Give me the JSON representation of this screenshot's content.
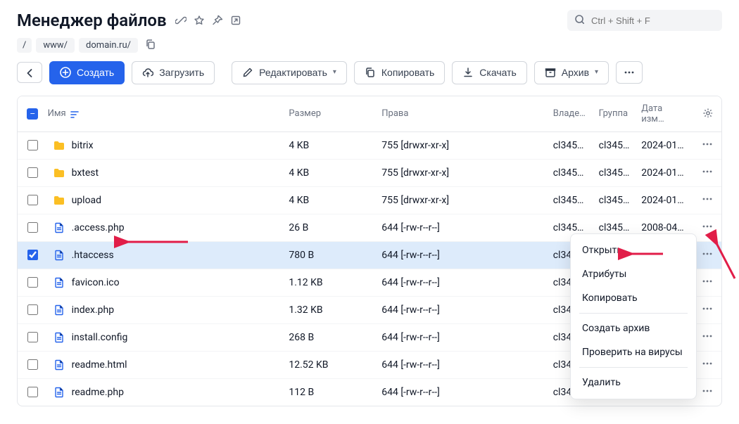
{
  "header": {
    "title": "Менеджер файлов"
  },
  "search": {
    "placeholder": "Ctrl + Shift + F"
  },
  "breadcrumb": {
    "root": "/",
    "parts": [
      "www/",
      "domain.ru/"
    ]
  },
  "toolbar": {
    "create": "Создать",
    "upload": "Загрузить",
    "edit": "Редактировать",
    "copy": "Копировать",
    "download": "Скачать",
    "archive": "Архив"
  },
  "columns": {
    "name": "Имя",
    "size": "Размер",
    "perm": "Права",
    "owner": "Владе…",
    "group": "Группа",
    "date": "Дата изм…"
  },
  "rows": [
    {
      "selected": false,
      "type": "folder",
      "name": "bitrix",
      "size": "4 KB",
      "perm": "755 [drwxr-xr-x]",
      "owner": "cl345…",
      "group": "cl345…",
      "date": "2024-01…"
    },
    {
      "selected": false,
      "type": "folder",
      "name": "bxtest",
      "size": "4 KB",
      "perm": "755 [drwxr-xr-x]",
      "owner": "cl345…",
      "group": "cl345…",
      "date": "2024-01…"
    },
    {
      "selected": false,
      "type": "folder",
      "name": "upload",
      "size": "4 KB",
      "perm": "755 [drwxr-xr-x]",
      "owner": "cl345…",
      "group": "cl345…",
      "date": "2024-01…"
    },
    {
      "selected": false,
      "type": "file",
      "name": ".access.php",
      "size": "26 B",
      "perm": "644 [-rw-r--r--]",
      "owner": "cl345…",
      "group": "cl345…",
      "date": "2008-04…"
    },
    {
      "selected": true,
      "type": "file",
      "name": ".htaccess",
      "size": "780 B",
      "perm": "644 [-rw-r--r--]",
      "owner": "cl345",
      "group": "",
      "date": ""
    },
    {
      "selected": false,
      "type": "file",
      "name": "favicon.ico",
      "size": "1.12 KB",
      "perm": "644 [-rw-r--r--]",
      "owner": "cl345",
      "group": "",
      "date": ""
    },
    {
      "selected": false,
      "type": "file",
      "name": "index.php",
      "size": "1.32 KB",
      "perm": "644 [-rw-r--r--]",
      "owner": "cl345",
      "group": "",
      "date": ""
    },
    {
      "selected": false,
      "type": "file",
      "name": "install.config",
      "size": "268 B",
      "perm": "644 [-rw-r--r--]",
      "owner": "cl345",
      "group": "",
      "date": ""
    },
    {
      "selected": false,
      "type": "file",
      "name": "readme.html",
      "size": "12.52 KB",
      "perm": "644 [-rw-r--r--]",
      "owner": "cl345",
      "group": "",
      "date": ""
    },
    {
      "selected": false,
      "type": "file",
      "name": "readme.php",
      "size": "112 B",
      "perm": "644 [-rw-r--r--]",
      "owner": "cl345",
      "group": "",
      "date": ""
    }
  ],
  "context_menu": {
    "open": "Открыть",
    "attrs": "Атрибуты",
    "copy": "Копировать",
    "archive": "Создать архив",
    "scan": "Проверить на вирусы",
    "delete": "Удалить"
  }
}
